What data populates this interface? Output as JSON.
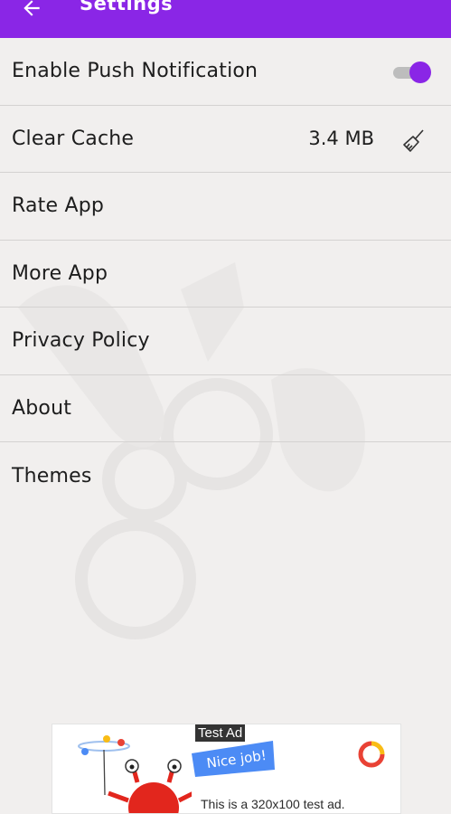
{
  "app_bar": {
    "title": "Settings",
    "back_icon": "arrow-back-icon",
    "color": "#8a26e6"
  },
  "settings": {
    "items": [
      {
        "label": "Enable Push Notification",
        "toggle_on": true
      },
      {
        "label": "Clear Cache",
        "value": "3.4 MB",
        "icon": "broom-icon"
      },
      {
        "label": "Rate App"
      },
      {
        "label": "More App"
      },
      {
        "label": "Privacy Policy"
      },
      {
        "label": "About"
      },
      {
        "label": "Themes"
      }
    ]
  },
  "ad": {
    "tag": "Test Ad",
    "badge": "Nice job!",
    "text": "This is a 320x100 test ad."
  }
}
